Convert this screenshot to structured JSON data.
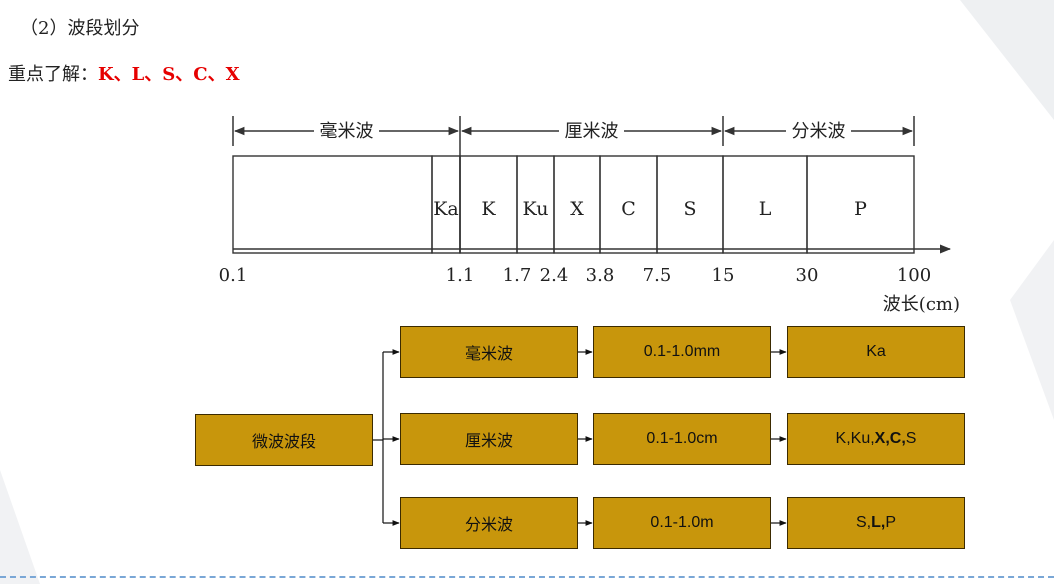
{
  "title": "（2）波段划分",
  "key_point": {
    "label": "重点了解：",
    "bands": "K、L、S、C、X"
  },
  "spectrum": {
    "ranges": [
      {
        "name": "毫米波",
        "from": 0.1,
        "to": 1.1
      },
      {
        "name": "厘米波",
        "from": 1.1,
        "to": 15
      },
      {
        "name": "分米波",
        "from": 15,
        "to": 100
      }
    ],
    "bands": [
      {
        "name": "",
        "from": 0.1,
        "to": 0.75
      },
      {
        "name": "Ka",
        "from": 0.75,
        "to": 1.1
      },
      {
        "name": "K",
        "from": 1.1,
        "to": 1.7
      },
      {
        "name": "Ku",
        "from": 1.7,
        "to": 2.4
      },
      {
        "name": "X",
        "from": 2.4,
        "to": 3.8
      },
      {
        "name": "C",
        "from": 3.8,
        "to": 7.5
      },
      {
        "name": "S",
        "from": 7.5,
        "to": 15
      },
      {
        "name": "L",
        "from": 15,
        "to": 30
      },
      {
        "name": "P",
        "from": 30,
        "to": 100
      }
    ],
    "ticks": [
      "0.1",
      "1.1",
      "1.7",
      "2.4",
      "3.8",
      "7.5",
      "15",
      "30",
      "100"
    ],
    "axis_label": "波长(cm)"
  },
  "tree": {
    "root": "微波波段",
    "rows": [
      {
        "name": "毫米波",
        "range": "0.1-1.0mm",
        "bands": [
          {
            "t": "Ka",
            "b": false
          }
        ]
      },
      {
        "name": "厘米波",
        "range": "0.1-1.0cm",
        "bands": [
          {
            "t": "K,Ku,",
            "b": false
          },
          {
            "t": "X,C,",
            "b": true
          },
          {
            "t": "S",
            "b": false
          }
        ]
      },
      {
        "name": "分米波",
        "range": "0.1-1.0m",
        "bands": [
          {
            "t": "S,",
            "b": false
          },
          {
            "t": "L,",
            "b": true
          },
          {
            "t": "P",
            "b": false
          }
        ]
      }
    ]
  },
  "colors": {
    "node_fill": "#c8960c",
    "key_bands": "#e60000",
    "footer_rule": "#7aa7d6"
  }
}
